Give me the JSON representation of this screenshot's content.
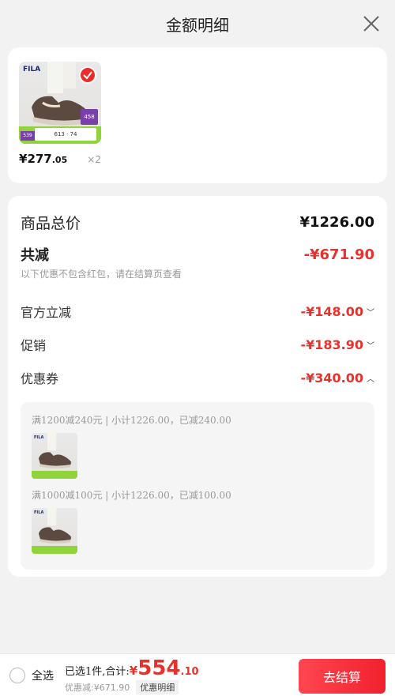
{
  "header": {
    "title": "金额明细"
  },
  "product": {
    "brand": "FILA",
    "badge": "458",
    "promo_text": "613 · 74",
    "tag_price": "539",
    "price_symbol": "¥",
    "price_int": "277",
    "price_dec": ".05",
    "qty": "×2"
  },
  "detail": {
    "total_label": "商品总价",
    "total_value": "¥1226.00",
    "reduce_label": "共减",
    "reduce_value": "-¥671.90",
    "note": "以下优惠不包含红包，请在结算页查看",
    "items": [
      {
        "label": "官方立减",
        "value": "-¥148.00"
      },
      {
        "label": "促销",
        "value": "-¥183.90"
      },
      {
        "label": "优惠券",
        "value": "-¥340.00"
      }
    ],
    "coupons": [
      {
        "text": "满1200减240元 | 小计1226.00，已减240.00"
      },
      {
        "text": "满1000减100元 | 小计1226.00，已减100.00"
      }
    ]
  },
  "footer": {
    "select_all": "全选",
    "selected_text": "已选1件,合计:",
    "currency": "¥",
    "total_int": "554",
    "total_dec": ".10",
    "discount_text": "优惠减:¥671.90",
    "detail_tag": "优惠明细",
    "pay_label": "去结算"
  },
  "colors": {
    "accent": "#e8312b",
    "page_bg": "#f2f2f2",
    "badge_green": "#8fd43a"
  }
}
